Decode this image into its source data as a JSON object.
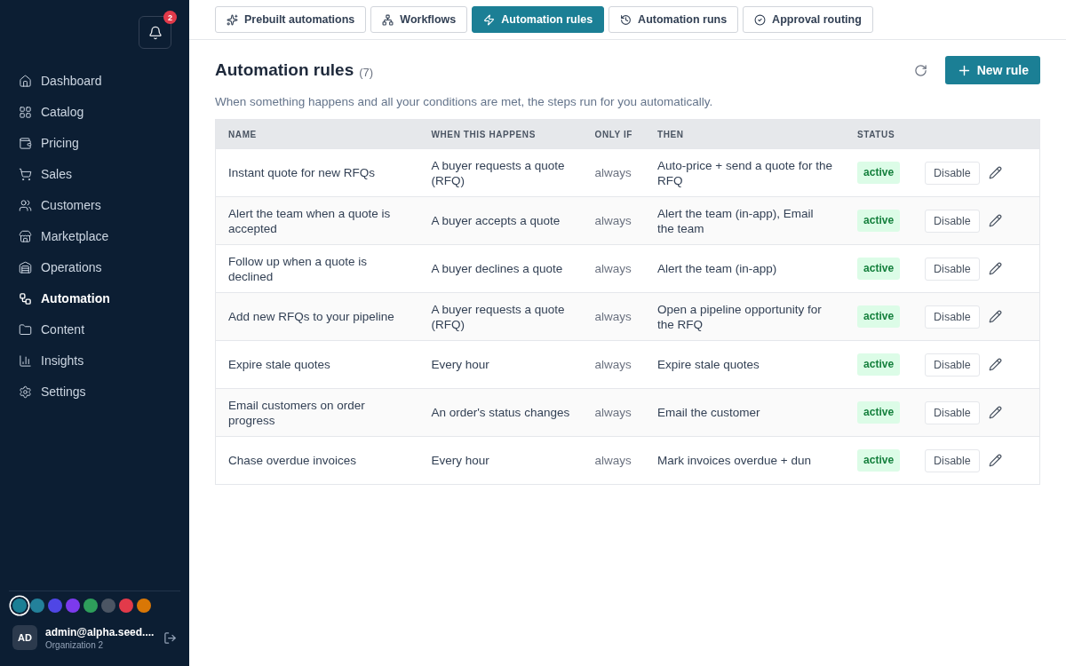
{
  "sidebar": {
    "notifications": {
      "count": "2"
    },
    "nav": [
      {
        "label": "Dashboard",
        "selected": false
      },
      {
        "label": "Catalog",
        "selected": false
      },
      {
        "label": "Pricing",
        "selected": false
      },
      {
        "label": "Sales",
        "selected": false
      },
      {
        "label": "Customers",
        "selected": false
      },
      {
        "label": "Marketplace",
        "selected": false
      },
      {
        "label": "Operations",
        "selected": false
      },
      {
        "label": "Automation",
        "selected": true
      },
      {
        "label": "Content",
        "selected": false
      },
      {
        "label": "Insights",
        "selected": false
      },
      {
        "label": "Settings",
        "selected": false
      }
    ],
    "theme_swatches": [
      {
        "color": "#1b7f95",
        "selected": true
      },
      {
        "color": "#23819a",
        "selected": false
      },
      {
        "color": "#4f46e5",
        "selected": false
      },
      {
        "color": "#7c3aed",
        "selected": false
      },
      {
        "color": "#2e9e5b",
        "selected": false
      },
      {
        "color": "#4b5563",
        "selected": false
      },
      {
        "color": "#e23a4a",
        "selected": false
      },
      {
        "color": "#d97706",
        "selected": false
      }
    ],
    "user": {
      "initials": "AD",
      "email": "admin@alpha.seed....",
      "organization": "Organization 2"
    }
  },
  "tabs": [
    {
      "label": "Prebuilt automations",
      "selected": false
    },
    {
      "label": "Workflows",
      "selected": false
    },
    {
      "label": "Automation rules",
      "selected": true
    },
    {
      "label": "Automation runs",
      "selected": false
    },
    {
      "label": "Approval routing",
      "selected": false
    }
  ],
  "page": {
    "title": "Automation rules",
    "count": "(7)",
    "new_button": "New rule",
    "description": "When something happens and all your conditions are met, the steps run for you automatically."
  },
  "table": {
    "columns": [
      "NAME",
      "WHEN THIS HAPPENS",
      "ONLY IF",
      "THEN",
      "STATUS"
    ],
    "rows": [
      {
        "name": "Instant quote for new RFQs",
        "when": "A buyer requests a quote (RFQ)",
        "only_if": "always",
        "then": "Auto-price + send a quote for the RFQ",
        "status": "active",
        "action": "Disable"
      },
      {
        "name": "Alert the team when a quote is accepted",
        "when": "A buyer accepts a quote",
        "only_if": "always",
        "then": "Alert the team (in-app), Email the team",
        "status": "active",
        "action": "Disable"
      },
      {
        "name": "Follow up when a quote is declined",
        "when": "A buyer declines a quote",
        "only_if": "always",
        "then": "Alert the team (in-app)",
        "status": "active",
        "action": "Disable"
      },
      {
        "name": "Add new RFQs to your pipeline",
        "when": "A buyer requests a quote (RFQ)",
        "only_if": "always",
        "then": "Open a pipeline opportunity for the RFQ",
        "status": "active",
        "action": "Disable"
      },
      {
        "name": "Expire stale quotes",
        "when": "Every hour",
        "only_if": "always",
        "then": "Expire stale quotes",
        "status": "active",
        "action": "Disable"
      },
      {
        "name": "Email customers on order progress",
        "when": "An order's status changes",
        "only_if": "always",
        "then": "Email the customer",
        "status": "active",
        "action": "Disable"
      },
      {
        "name": "Chase overdue invoices",
        "when": "Every hour",
        "only_if": "always",
        "then": "Mark invoices overdue + dun",
        "status": "active",
        "action": "Disable"
      }
    ]
  }
}
